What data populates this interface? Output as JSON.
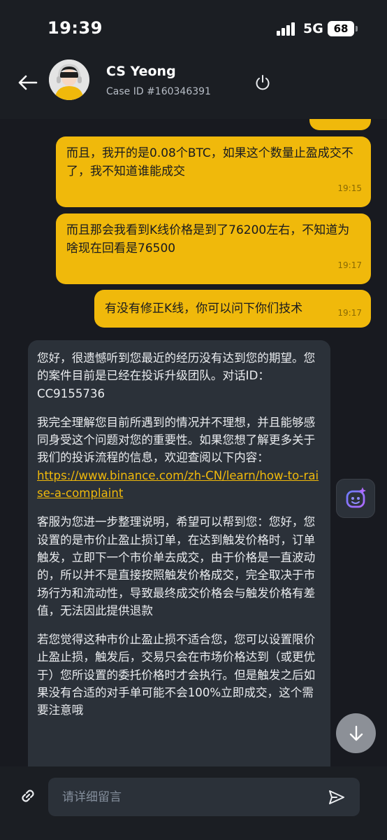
{
  "status_bar": {
    "time": "19:39",
    "network": "5G",
    "battery": "68"
  },
  "header": {
    "agent_name": "CS Yeong",
    "case_id": "Case ID #160346391"
  },
  "messages_out": [
    {
      "text": "而且，我开的是0.08个BTC，如果这个数量止盈成交不了，我不知道谁能成交",
      "time": "19:15"
    },
    {
      "text": "而且那会我看到K线价格是到了76200左右，不知道为啥现在回看是76500",
      "time": "19:17"
    },
    {
      "text": "有没有修正K线，你可以问下你们技术",
      "time": "19:17"
    }
  ],
  "message_in": {
    "p1": "您好，很遗憾听到您最近的经历没有达到您的期望。您的案件目前是已经在投诉升级团队。对话ID：CC9155736",
    "p2": "我完全理解您目前所遇到的情况并不理想，并且能够感同身受这个问题对您的重要性。如果您想了解更多关于我们的投诉流程的信息，欢迎查阅以下内容：",
    "link": "https://www.binance.com/zh-CN/learn/how-to-raise-a-complaint",
    "p3": "客服为您进一步整理说明，希望可以帮到您：您好，您设置的是市价止盈止损订单，在达到触发价格时，订单触发，立即下一个市价单去成交，由于价格是一直波动的，所以并不是直接按照触发价格成交，完全取决于市场行为和流动性，导致最终成交价格会与触发价格有差值，无法因此提供退款",
    "p4": "若您觉得这种市价止盈止损不适合您，您可以设置限价止盈止损，触发后，交易只会在市场价格达到（或更优于）您所设置的委托价格时才会执行。但是触发之后如果没有合适的对手单可能不会100%立即成交，这个需要注意哦"
  },
  "input": {
    "placeholder": "请详细留言"
  },
  "colors": {
    "accent": "#f0b90b",
    "background": "#181a20",
    "bubble_in": "#2b3139"
  },
  "icons": [
    "back-arrow-icon",
    "power-icon",
    "ai-assistant-icon",
    "arrow-down-icon",
    "link-icon",
    "send-icon"
  ]
}
